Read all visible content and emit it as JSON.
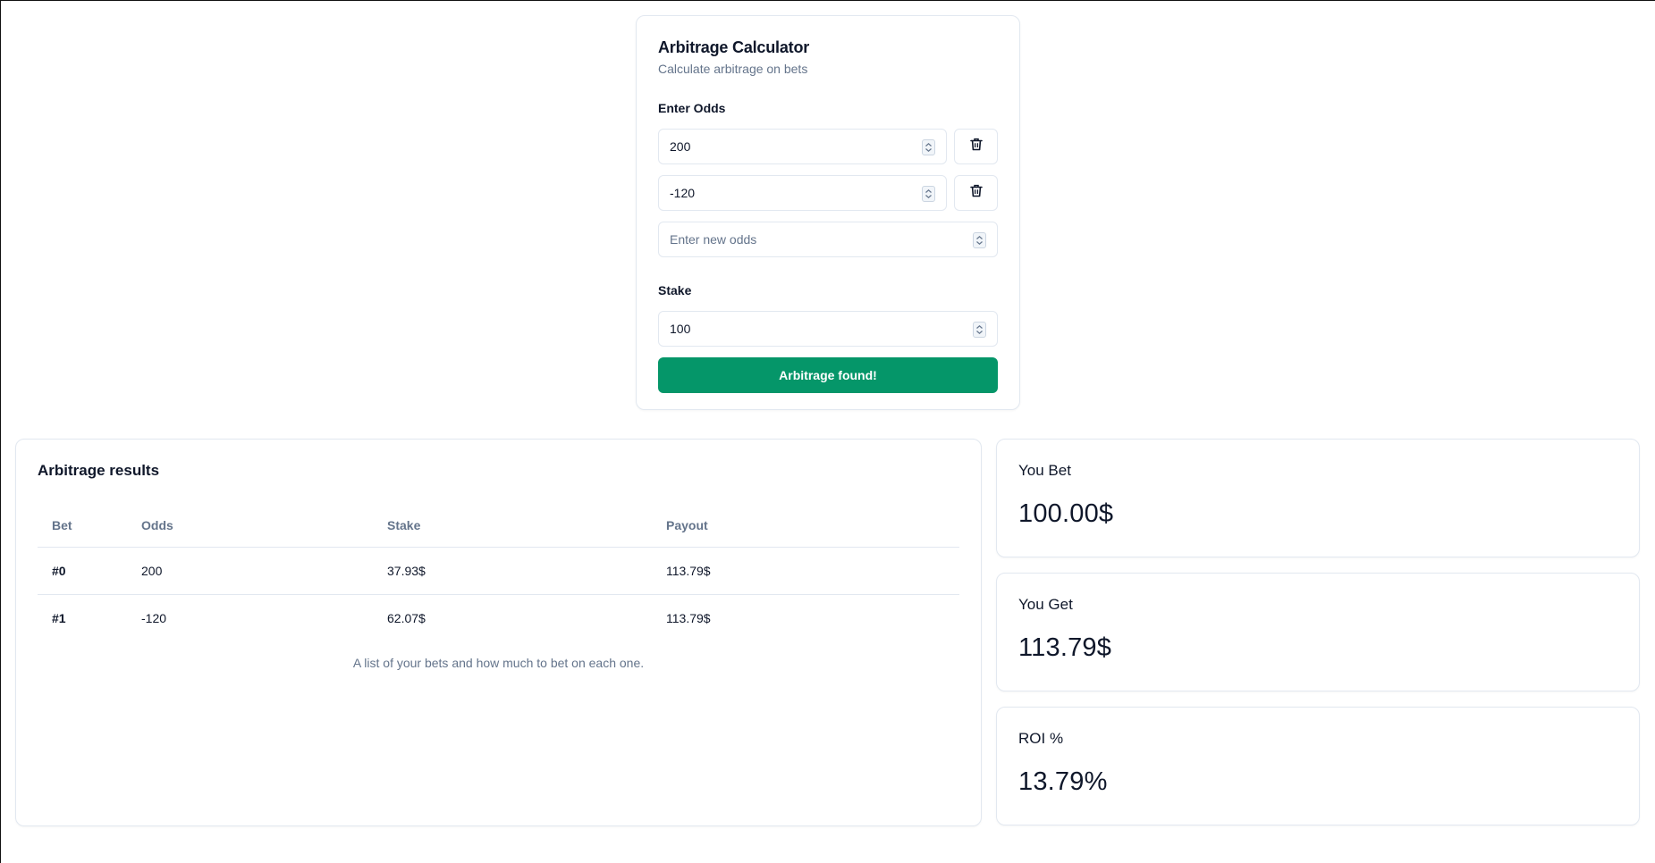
{
  "calculator": {
    "title": "Arbitrage Calculator",
    "subtitle": "Calculate arbitrage on bets",
    "odds_label": "Enter Odds",
    "odds": [
      {
        "value": "200"
      },
      {
        "value": "-120"
      }
    ],
    "new_odds_placeholder": "Enter new odds",
    "stake_label": "Stake",
    "stake_value": "100",
    "action_label": "Arbitrage found!",
    "accent_color": "#059669"
  },
  "results": {
    "title": "Arbitrage results",
    "columns": [
      "Bet",
      "Odds",
      "Stake",
      "Payout"
    ],
    "rows": [
      {
        "bet": "#0",
        "odds": "200",
        "stake": "37.93$",
        "payout": "113.79$"
      },
      {
        "bet": "#1",
        "odds": "-120",
        "stake": "62.07$",
        "payout": "113.79$"
      }
    ],
    "caption": "A list of your bets and how much to bet on each one."
  },
  "stats": {
    "bet": {
      "label": "You Bet",
      "value": "100.00$"
    },
    "get": {
      "label": "You Get",
      "value": "113.79$"
    },
    "roi": {
      "label": "ROI %",
      "value": "13.79%"
    }
  },
  "icons": {
    "delete": "trash-icon",
    "spinner": "spinner-icon"
  }
}
